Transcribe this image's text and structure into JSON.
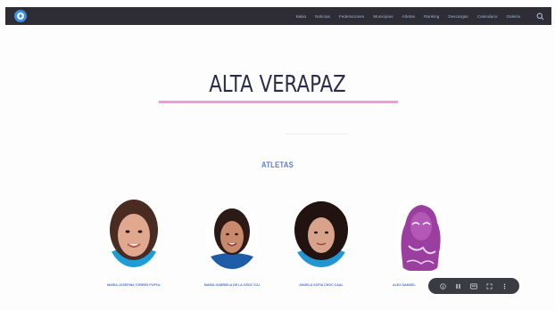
{
  "nav": {
    "items": [
      {
        "label": "Inicio",
        "active": true
      },
      {
        "label": "Noticias",
        "active": false
      },
      {
        "label": "Federaciones",
        "active": false
      },
      {
        "label": "Municipios",
        "active": false
      },
      {
        "label": "Atletas",
        "active": false
      },
      {
        "label": "Ranking",
        "active": false
      },
      {
        "label": "Descargas",
        "active": false
      },
      {
        "label": "Calendario",
        "active": false
      },
      {
        "label": "Galería",
        "active": false
      }
    ],
    "colors": {
      "bar": "#2e2d35",
      "link": "#9fb8d8",
      "logo": "#3c8ee0"
    }
  },
  "page": {
    "title": "ALTA VERAPAZ",
    "section_title": "ATLETAS",
    "accent_rule_color": "#f29bd5"
  },
  "athletes": [
    {
      "name": "MARIA JOSEFINA TORRES POPOL"
    },
    {
      "name": "MARIA GABRIELA DE LA CRUZ COJ"
    },
    {
      "name": "ANGELA SOFIA CHOC CAAL"
    },
    {
      "name": "ALEX SAMUEL"
    }
  ],
  "float_bar": {
    "icons": [
      "info-icon",
      "pause-icon",
      "caption-icon",
      "expand-icon",
      "more-icon"
    ]
  }
}
